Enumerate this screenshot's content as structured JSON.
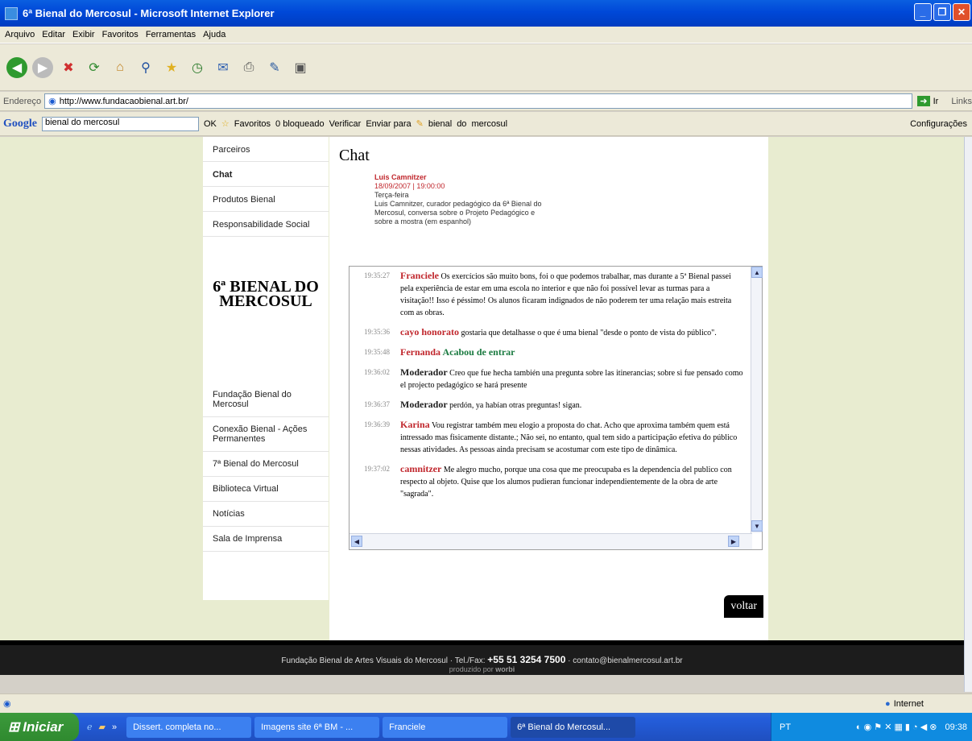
{
  "window": {
    "title": "6ª Bienal do Mercosul - Microsoft Internet Explorer"
  },
  "menu": [
    "Arquivo",
    "Editar",
    "Exibir",
    "Favoritos",
    "Ferramentas",
    "Ajuda"
  ],
  "address": {
    "label": "Endereço",
    "url": "http://www.fundacaobienal.art.br/",
    "go": "Ir",
    "links": "Links"
  },
  "google": {
    "label": "Google",
    "query": "bienal do mercosul",
    "ok": "OK",
    "favoritos": "Favoritos",
    "blocked": "0 bloqueado",
    "verificar": "Verificar",
    "enviar": "Enviar para",
    "words": [
      "bienal",
      "do",
      "mercosul"
    ],
    "config": "Configurações"
  },
  "nav": {
    "top": [
      "Parceiros",
      "Chat",
      "Produtos Bienal",
      "Responsabilidade Social"
    ],
    "logo": "6ª BIENAL DO MERCOSUL",
    "bottom": [
      "Fundação Bienal do Mercosul",
      "Conexão Bienal - Ações Permanentes",
      "7ª Bienal do Mercosul",
      "Biblioteca Virtual",
      "Notícias",
      "Sala de Imprensa"
    ]
  },
  "main": {
    "title": "Chat",
    "event": {
      "name": "Luis Camnitzer",
      "date": "18/09/2007 | 19:00:00",
      "day": "Terça-feira",
      "desc": "Luis Camnitzer, curador pedagógico da 6ª Bienal do Mercosul, conversa sobre o Projeto Pedagógico e sobre a mostra (em espanhol)"
    }
  },
  "chat": [
    {
      "time": "19:35:27",
      "author": "Franciele",
      "text": "Os exercícios são muito bons, foi o que podemos trabalhar, mas durante a 5ª Bienal passei pela experiência de estar em uma escola no interior e que não foi possível levar as turmas para a visitação!! Isso é péssimo! Os alunos ficaram indignados de não poderem ter uma relação mais estreita com as obras."
    },
    {
      "time": "19:35:36",
      "author": "cayo honorato",
      "text": "gostaria que detalhasse o que é uma bienal \"desde o ponto de vista do público\"."
    },
    {
      "time": "19:35:48",
      "author": "Fernanda",
      "text": "Acabou de entrar"
    },
    {
      "time": "19:36:02",
      "author": "Moderador",
      "text": "Creo que fue hecha también una pregunta sobre las itinerancias; sobre si fue pensado como el projecto pedagógico se hará presente"
    },
    {
      "time": "19:36:37",
      "author": "Moderador",
      "text": "perdón, ya habían otras preguntas! sigan."
    },
    {
      "time": "19:36:39",
      "author": "Karina",
      "text": "Vou registrar também meu elogio a proposta do chat. Acho que aproxima também quem está intressado mas fisicamente distante.; Não sei, no entanto, qual tem sido a participação efetiva do público nessas atividades. As pessoas ainda precisam se acostumar com este tipo de dinâmica."
    },
    {
      "time": "19:37:02",
      "author": "camnitzer",
      "text": "Me alegro mucho, porque una cosa que me preocupaba es la dependencia del publico con respecto al objeto. Quise que los alumos pudieran funcionar independientemente de la obra de arte \"sagrada\"."
    }
  ],
  "voltar": "voltar",
  "footer": {
    "org": "Fundação Bienal de Artes Visuais do Mercosul · Tel./Fax:",
    "phone": "+55 51 3254 7500",
    "email": "· contato@bienalmercosul.art.br",
    "produced": "produzido por",
    "brand": "worbi"
  },
  "status": {
    "zone": "Internet"
  },
  "taskbar": {
    "start": "Iniciar",
    "tasks": [
      "Dissert. completa no...",
      "Imagens site 6ª BM - ...",
      "Franciele",
      "6ª Bienal do Mercosul..."
    ],
    "lang": "PT",
    "clock": "09:38"
  }
}
